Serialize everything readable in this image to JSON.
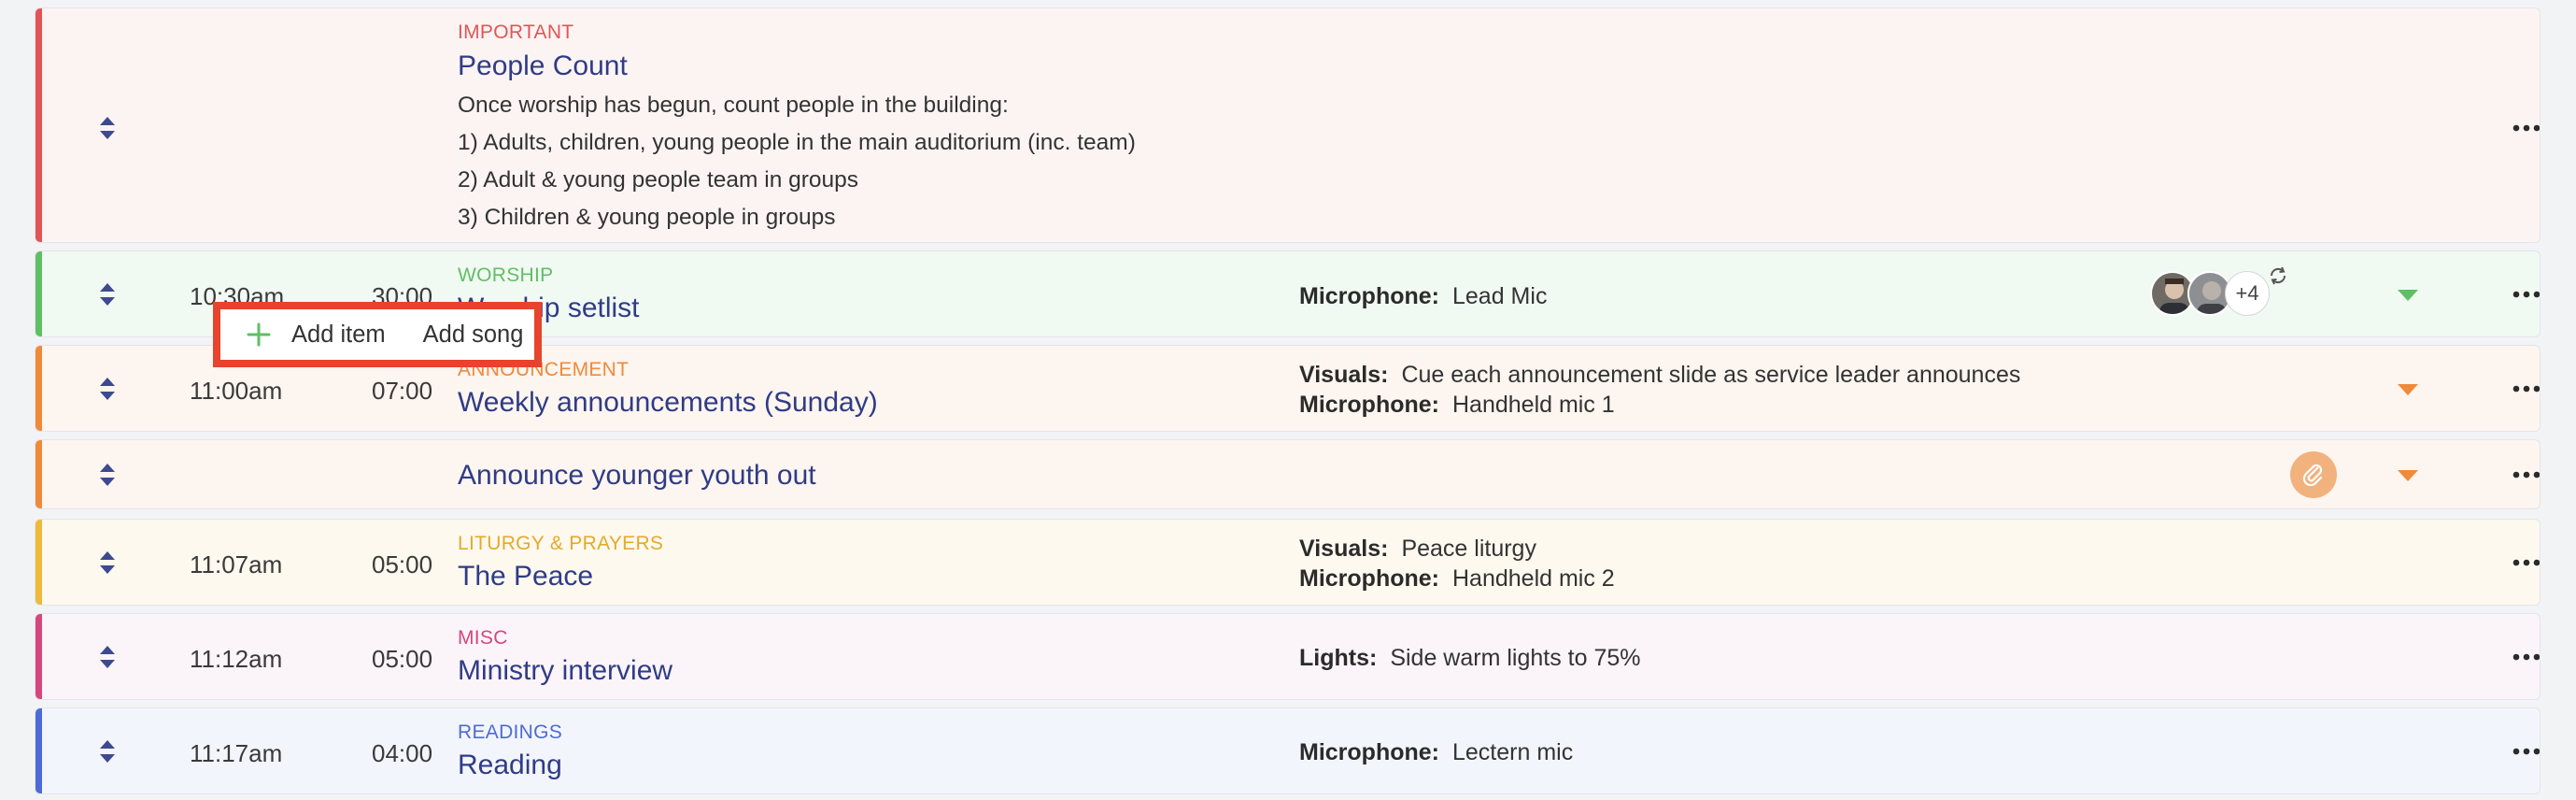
{
  "colors": {
    "important": "#e25554",
    "worship": "#5fbf63",
    "announcement": "#ef8a3b",
    "liturgy": "#efb93b",
    "misc": "#d6467f",
    "readings": "#4d6bd6",
    "highlight": "#e8432c",
    "title": "#2f3c86"
  },
  "popover": {
    "add_item_label": "Add item",
    "add_song_label": "Add song"
  },
  "rows": [
    {
      "category": "IMPORTANT",
      "title": "People Count",
      "description": [
        "Once worship has begun, count people in the building:",
        "1) Adults, children, young people in the main auditorium (inc. team)",
        "2) Adult & young people team in groups",
        "3) Children & young people in groups"
      ]
    },
    {
      "category": "WORSHIP",
      "time": "10:30am",
      "duration": "30:00",
      "title": "Worship setlist",
      "notes": [
        {
          "key": "Microphone:",
          "value": "Lead Mic"
        }
      ],
      "avatars_extra": "+4"
    },
    {
      "category": "ANNOUNCEMENT",
      "time": "11:00am",
      "duration": "07:00",
      "title": "Weekly announcements (Sunday)",
      "notes": [
        {
          "key": "Visuals:",
          "value": "Cue each announcement slide as service leader announces"
        },
        {
          "key": "Microphone:",
          "value": "Handheld mic 1"
        }
      ]
    },
    {
      "title": "Announce younger youth out"
    },
    {
      "category": "LITURGY & PRAYERS",
      "time": "11:07am",
      "duration": "05:00",
      "title": "The Peace",
      "notes": [
        {
          "key": "Visuals:",
          "value": "Peace liturgy"
        },
        {
          "key": "Microphone:",
          "value": "Handheld mic 2"
        }
      ]
    },
    {
      "category": "MISC",
      "time": "11:12am",
      "duration": "05:00",
      "title": "Ministry interview",
      "notes": [
        {
          "key": "Lights:",
          "value": "Side warm lights to 75%"
        }
      ]
    },
    {
      "category": "READINGS",
      "time": "11:17am",
      "duration": "04:00",
      "title": "Reading",
      "notes": [
        {
          "key": "Microphone:",
          "value": "Lectern mic"
        }
      ]
    }
  ]
}
